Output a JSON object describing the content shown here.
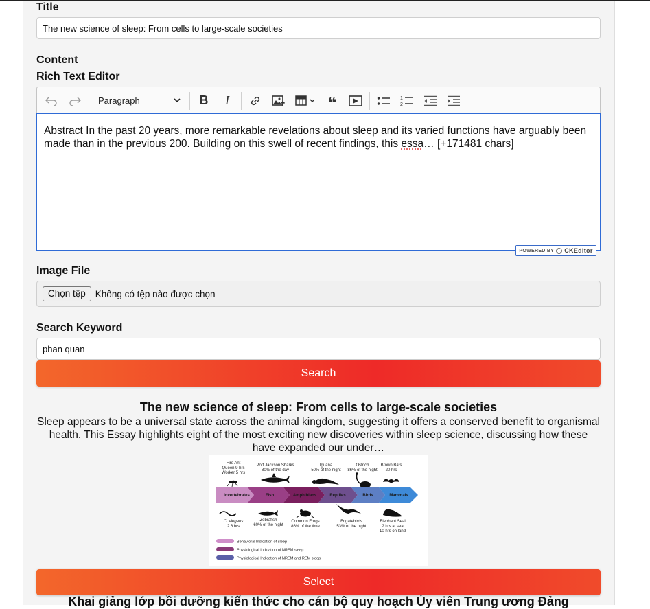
{
  "form": {
    "title_label": "Title",
    "title_value": "The new science of sleep: From cells to large-scale societies",
    "content_label": "Content",
    "rte_label": "Rich Text Editor",
    "editor": {
      "paragraph_select": "Paragraph",
      "text_before": "Abstract In the past 20 years, more remarkable revelations about sleep and its varied functions have arguably been made than in the previous 200. Building on this swell of recent findings, this ",
      "text_spell": "essa",
      "text_after": "… [+171481 chars]",
      "powered_by": "POWERED BY",
      "powered_brand": "CKEditor",
      "toolbar_icons": [
        "undo-icon",
        "redo-icon",
        "bold-icon",
        "italic-icon",
        "link-icon",
        "image-upload-icon",
        "table-icon",
        "blockquote-icon",
        "media-embed-icon",
        "bulleted-list-icon",
        "numbered-list-icon",
        "outdent-icon",
        "indent-icon"
      ],
      "toolbar_labels": {
        "bold": "B",
        "italic": "I",
        "quote": "❝"
      }
    },
    "image_label": "Image File",
    "file_button": "Chọn tệp",
    "file_status": "Không có tệp nào được chọn",
    "search_label": "Search Keyword",
    "search_value": "phan quan",
    "search_button": "Search"
  },
  "results": [
    {
      "title": "The new science of sleep: From cells to large-scale societies",
      "description": "Sleep appears to be a universal state across the animal kingdom, suggesting it offers a conserved benefit to organismal health. This Essay highlights eight of the most exciting new discoveries within sleep science, discussing how these have expanded our under…",
      "select_button": "Select",
      "figure": {
        "top_labels": [
          [
            "Fire Ant",
            "Queen 9 hrs",
            "Worker 5 hrs"
          ],
          [
            "Port Jackson Sharks",
            "80% of the day"
          ],
          [
            "Iguana",
            "50% of the night"
          ],
          [
            "Ostrich",
            "86% of the night"
          ],
          [
            "Brown Bats",
            "20 hrs"
          ]
        ],
        "arrow_labels": [
          "Invertebrates",
          "Fish",
          "Amphibians",
          "Reptiles",
          "Birds",
          "Mammals"
        ],
        "arrow_colors": [
          "#c98cc2",
          "#9a3f86",
          "#7a1f5e",
          "#6e4f8e",
          "#5d7fc4",
          "#3e8ad8"
        ],
        "bottom_labels": [
          [
            "C. elegans",
            "2.6 hrs"
          ],
          [
            "Zebrafish",
            "60% of the night"
          ],
          [
            "Common Frogs",
            "86% of the time"
          ],
          [
            "Frigatebirds",
            "53% of the night"
          ],
          [
            "Elephant Seal",
            "2 hrs at sea",
            "10 hrs on land"
          ]
        ],
        "legend": [
          {
            "label": "Behavioral Indication of sleep",
            "color": "#cf8ec9"
          },
          {
            "label": "Physiological Indication of NREM sleep",
            "color": "#8a3a78"
          },
          {
            "label": "Physiological Indication of NREM and REM sleep",
            "color": "#5a5fa8"
          }
        ]
      }
    },
    {
      "title": "Khai giảng lớp bồi dưỡng kiến thức cho cán bộ quy hoạch Ủy viên Trung ương Đảng"
    }
  ]
}
